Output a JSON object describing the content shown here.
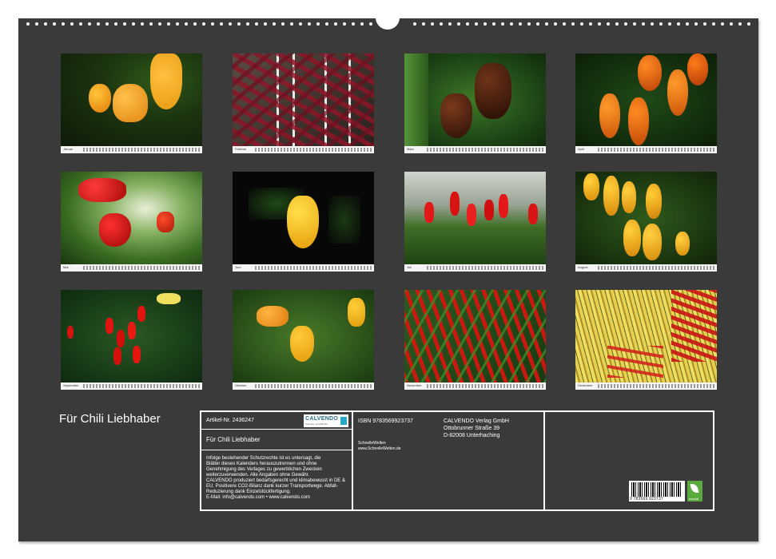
{
  "calendar_title": "Für Chili Liebhaber",
  "months": [
    {
      "label": "Januar"
    },
    {
      "label": "Februar"
    },
    {
      "label": "März"
    },
    {
      "label": "April"
    },
    {
      "label": "Mai"
    },
    {
      "label": "Juni"
    },
    {
      "label": "Juli"
    },
    {
      "label": "August"
    },
    {
      "label": "September"
    },
    {
      "label": "Oktober"
    },
    {
      "label": "November"
    },
    {
      "label": "Dezember"
    }
  ],
  "info": {
    "article_label": "Artikel-Nr. 2436247",
    "publisher_logo": "CALVENDO",
    "publisher_logo_sub": "Kalender und Bücher",
    "product_title": "Für Chili Liebhaber",
    "legal_text": "Infolge bestehender Schutzrechte ist es untersagt, die\nBlätter dieses Kalenders herauszutrennen und ohne\nGenehmigung des Verlages zu gewerblichen Zwecken\nweiterzuverwenden. Alle Angaben ohne Gewähr.\nCALVENDO produziert bedarfsgerecht und klimabewusst in DE &\nEU. Positivere CO2-Bilanz dank kurzer Transportwege. Abfall-\nReduzierung dank Einzelstückfertigung.\nE-Mail: info@calvendo.com • www.calvendo.com",
    "isbn": "ISBN 9783569923737",
    "publisher_name": "CALVENDO Verlag GmbH",
    "publisher_street": "Ottobrunner Straße 39",
    "publisher_city": "D-82008 Unterhaching",
    "author": "SchnelleWelten",
    "author_url": "www.SchnelleWelten.de",
    "barcode_number": "9 783569 923737",
    "eco_label": "neutral"
  },
  "colors": {
    "sheet": "#3a3a3a",
    "border": "#ffffff",
    "logo_blue": "#2c6d8c",
    "eco_green": "#5aaa3e"
  }
}
